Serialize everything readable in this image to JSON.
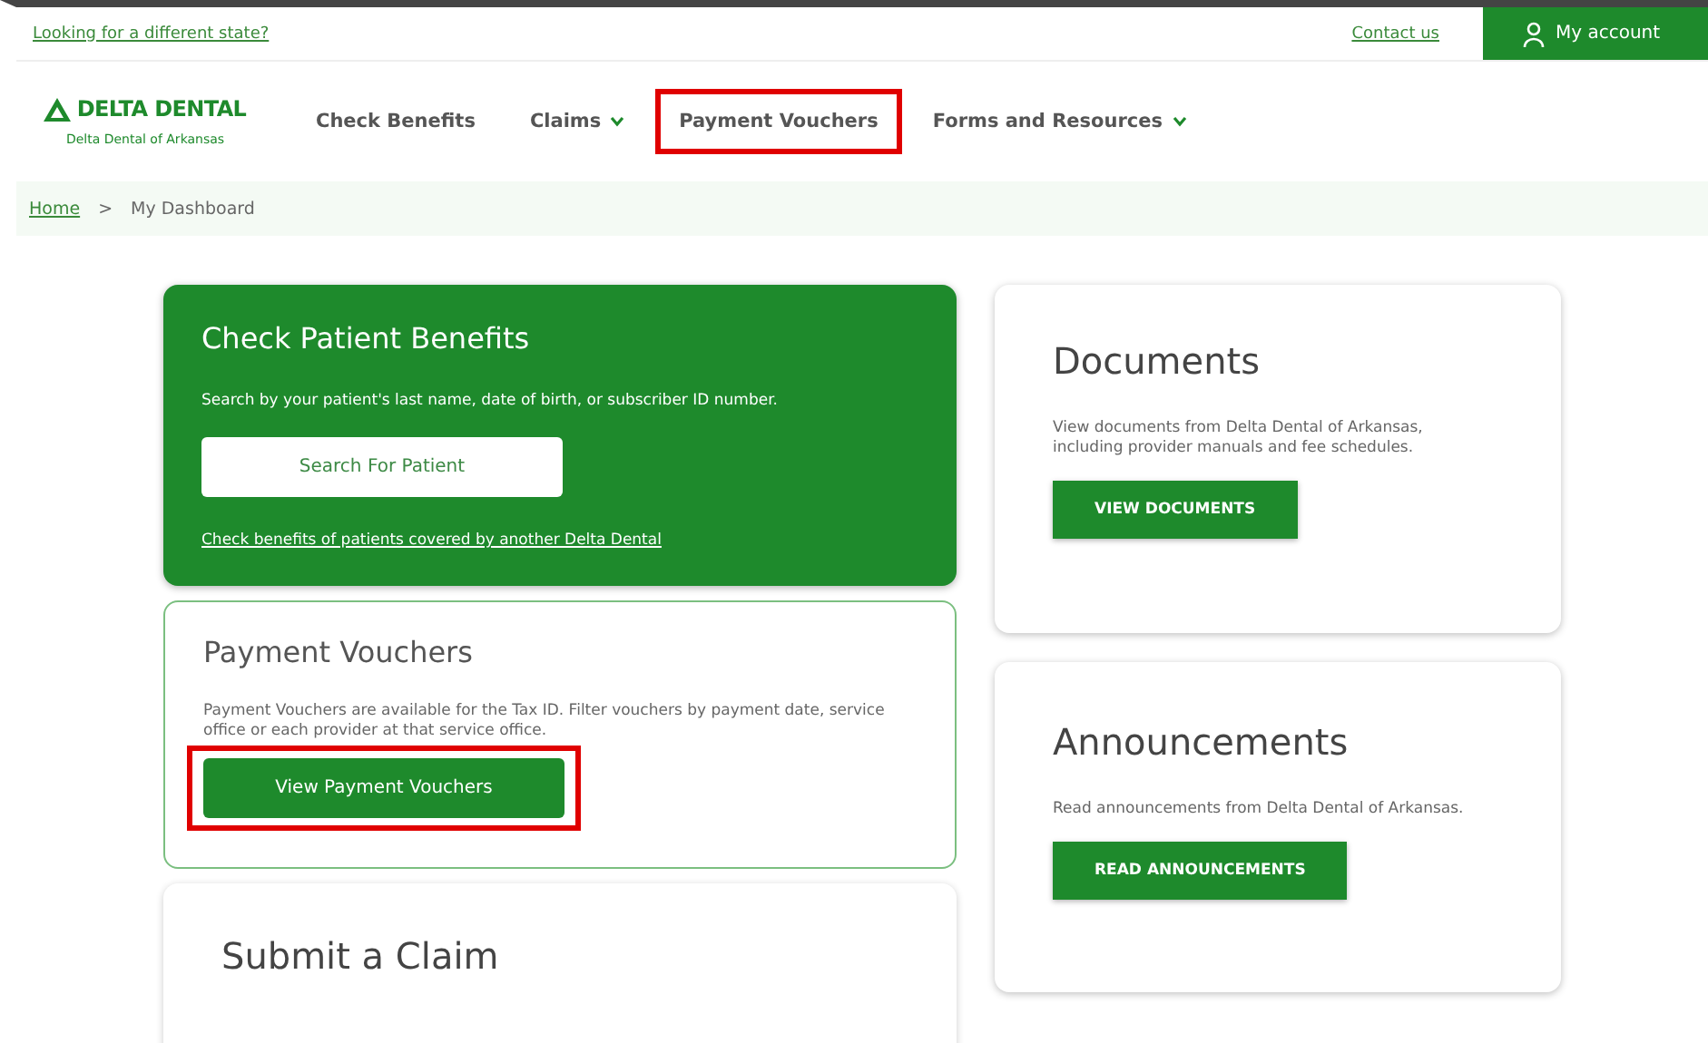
{
  "top_bar": {
    "state_link": "Looking for a different state?",
    "contact_link": "Contact us",
    "account_button": "My account"
  },
  "logo": {
    "brand": "DELTA DENTAL",
    "sub": "Delta Dental of Arkansas"
  },
  "nav": [
    {
      "label": "Check Benefits",
      "dropdown": false,
      "highlighted": false
    },
    {
      "label": "Claims",
      "dropdown": true,
      "highlighted": false
    },
    {
      "label": "Payment Vouchers",
      "dropdown": false,
      "highlighted": true
    },
    {
      "label": "Forms and Resources",
      "dropdown": true,
      "highlighted": false
    }
  ],
  "breadcrumb": {
    "home": "Home",
    "separator": ">",
    "current": "My Dashboard"
  },
  "left_cards": [
    {
      "kind": "green",
      "title": "Check Patient Benefits",
      "text": "Search by your patient's last name, date of birth, or subscriber ID number.",
      "button": {
        "label": "Search For Patient",
        "highlighted": false
      },
      "link": "Check benefits of patients covered by another Delta Dental"
    },
    {
      "kind": "outlined",
      "title": "Payment Vouchers",
      "text": "Payment Vouchers are available for the Tax ID. Filter vouchers by payment date, service office or each provider at that service office.",
      "button": {
        "label": "View Payment Vouchers",
        "highlighted": true
      }
    },
    {
      "kind": "plain",
      "title": "Submit a Claim"
    }
  ],
  "right_cards": [
    {
      "title": "Documents",
      "text": "View documents from Delta Dental of Arkansas, including provider manuals and fee schedules.",
      "button": "VIEW DOCUMENTS"
    },
    {
      "title": "Announcements",
      "text": "Read announcements from Delta Dental of Arkansas.",
      "button": "READ ANNOUNCEMENTS"
    }
  ]
}
